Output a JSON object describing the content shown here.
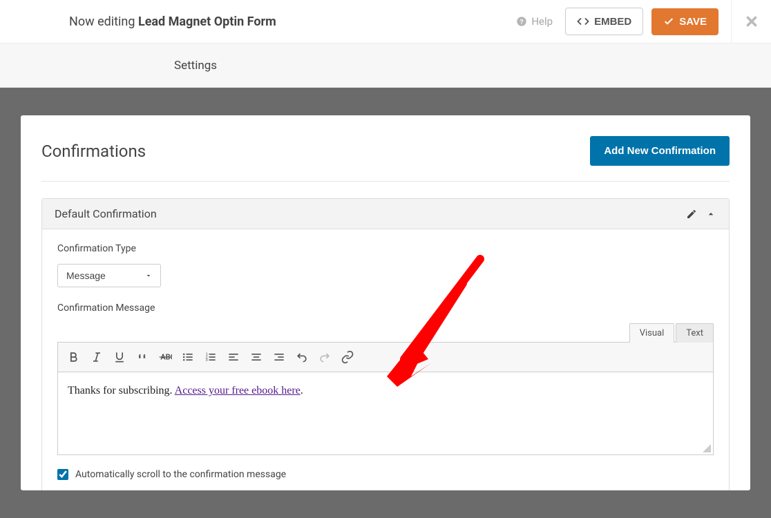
{
  "header": {
    "prefix": "Now editing",
    "form_name": "Lead Magnet Optin Form",
    "help_label": "Help",
    "embed_label": "EMBED",
    "save_label": "SAVE"
  },
  "subbar": {
    "title": "Settings"
  },
  "panel": {
    "title": "Confirmations",
    "add_button": "Add New Confirmation"
  },
  "confirmation": {
    "name": "Default Confirmation",
    "type_label": "Confirmation Type",
    "type_value": "Message",
    "message_label": "Confirmation Message",
    "editor_tabs": {
      "visual": "Visual",
      "text": "Text"
    },
    "message_text": "Thanks for subscribing. ",
    "message_link_text": "Access your free ebook here",
    "message_suffix": ".",
    "scroll_checkbox_label": "Automatically scroll to the confirmation message",
    "scroll_checkbox_checked": true
  },
  "colors": {
    "primary": "#e27730",
    "add": "#0073aa",
    "arrow": "#ff0000"
  }
}
